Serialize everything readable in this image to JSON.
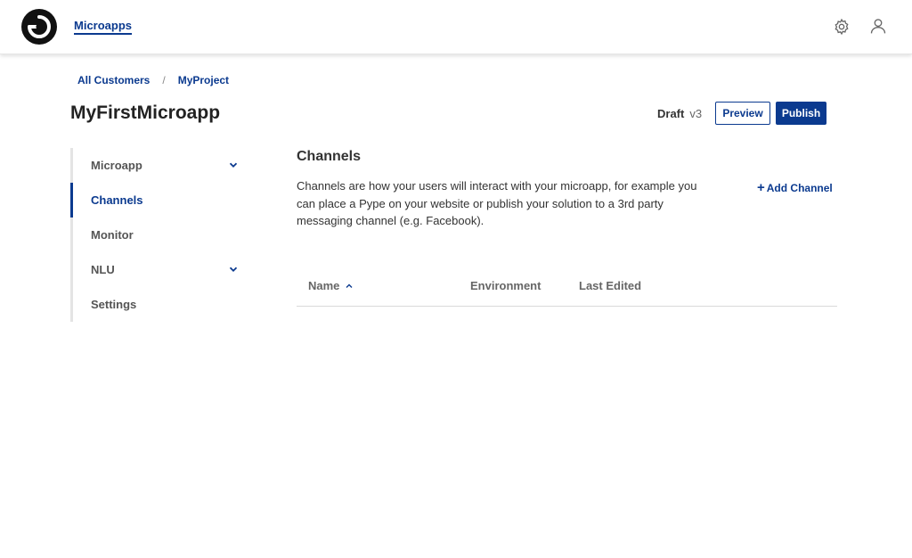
{
  "header": {
    "app_link": "Microapps",
    "icons": {
      "logo": "brand-logo",
      "settings": "gear-icon",
      "account": "user-icon"
    }
  },
  "breadcrumb": {
    "items": [
      "All Customers",
      "MyProject"
    ],
    "separator": "/"
  },
  "page": {
    "title": "MyFirstMicroapp",
    "status": "Draft",
    "version": "v3",
    "preview_label": "Preview",
    "publish_label": "Publish"
  },
  "sidebar": {
    "items": [
      {
        "label": "Microapp",
        "expandable": true,
        "active": false
      },
      {
        "label": "Channels",
        "expandable": false,
        "active": true
      },
      {
        "label": "Monitor",
        "expandable": false,
        "active": false
      },
      {
        "label": "NLU",
        "expandable": true,
        "active": false
      },
      {
        "label": "Settings",
        "expandable": false,
        "active": false
      }
    ]
  },
  "main": {
    "title": "Channels",
    "description": "Channels are how your users will interact with your microapp, for example you can place a Pype on your website or publish your solution to a 3rd party messaging channel (e.g. Facebook).",
    "add_label": "Add Channel",
    "add_icon": "+",
    "table": {
      "columns": [
        "Name",
        "Environment",
        "Last Edited"
      ],
      "rows": []
    }
  },
  "colors": {
    "accent": "#0b3a8f",
    "text": "#333333",
    "muted": "#666666"
  }
}
